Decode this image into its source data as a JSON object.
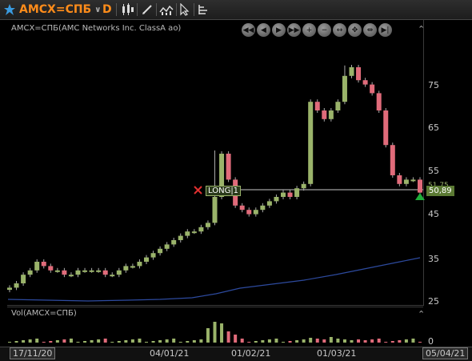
{
  "toolbar": {
    "symbol": "AMCX=СПБ",
    "interval": "D",
    "icons": [
      "star-icon",
      "candlestick-icon",
      "pencil-icon",
      "indicator-icon",
      "cursor-icon",
      "order-icon"
    ]
  },
  "chart": {
    "title": "AMCX=СПБ(AMC Networks Inc. ClassA ao)",
    "volume_title": "Vol(AMCX=СПБ)",
    "price_ticks": [
      "75",
      "65",
      "55",
      "45",
      "35",
      "25"
    ],
    "volume_tick": "0",
    "last_price": "50,89",
    "last_price_small": "51,75",
    "position_label": "LONG|1",
    "x_labels": [
      "17/11/20",
      "04/01/21",
      "01/02/21",
      "01/03/21",
      "05/04/21"
    ]
  },
  "chart_data": {
    "type": "candlestick",
    "y_axis_ticks": [
      25,
      35,
      45,
      55,
      65,
      75
    ],
    "series": [
      {
        "name": "AMCX=СПБ",
        "values": [
          29,
          30,
          32,
          33,
          35,
          34,
          33,
          33,
          32,
          32,
          33,
          33,
          33,
          33,
          32,
          32,
          33,
          34,
          34,
          35,
          36,
          37,
          38,
          39,
          40,
          41,
          42,
          42,
          43,
          44,
          50,
          60,
          54,
          48,
          47,
          46,
          47,
          48,
          49,
          50,
          51,
          50,
          52,
          53,
          72,
          70,
          68,
          70,
          72,
          78,
          80,
          77,
          76,
          74,
          70,
          62,
          55,
          53,
          54,
          54,
          51
        ]
      }
    ]
  },
  "colors": {
    "up": "#9ab36a",
    "down": "#e06b7a",
    "ma": "#2d4a9e",
    "accent": "#ff8c1a"
  }
}
